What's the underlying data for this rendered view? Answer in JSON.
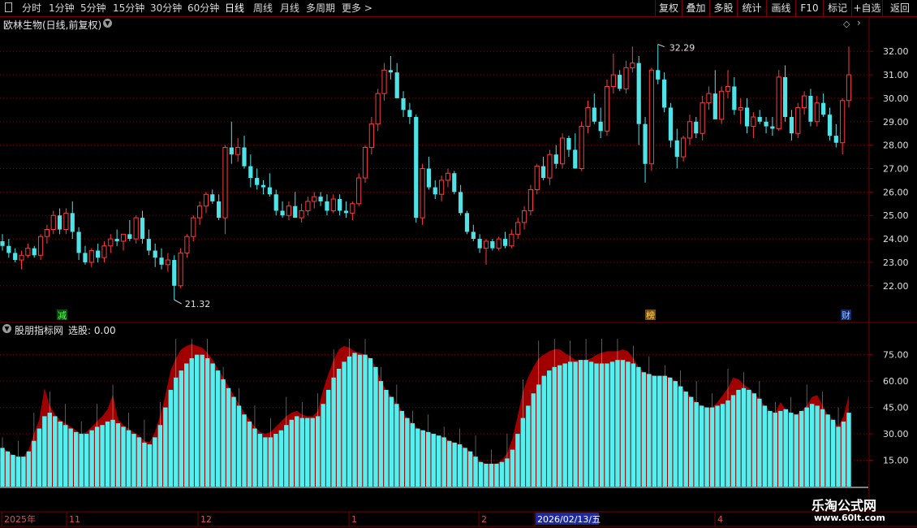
{
  "toolbar": {
    "menu_icon": "window-icon",
    "left": [
      "分时",
      "1分钟",
      "5分钟",
      "15分钟",
      "30分钟",
      "60分钟",
      "日线",
      "周线",
      "月线",
      "多周期",
      "更多 >"
    ],
    "active": "日线",
    "right": [
      "复权",
      "叠加",
      "多股",
      "统计",
      "画线",
      "F10",
      "标记",
      "+自选",
      "返回"
    ]
  },
  "stock": {
    "title": "欧林生物(日线,前复权)"
  },
  "indicator": {
    "name": "股朋指标网",
    "label": "选股: 0.00"
  },
  "annotations": {
    "high": "32.29",
    "low": "21.32",
    "marker_jian": "减",
    "marker_bang": "榜",
    "marker_cai": "财"
  },
  "colors": {
    "up": "#ff3b3b",
    "down": "#4fe3e8",
    "bar": "#54f0f0",
    "overlay": "#a00000",
    "grid": "#7a0000",
    "axis": "#e0e0e0"
  },
  "watermark": {
    "title": "乐淘公式网",
    "url": "www.60lt.com"
  },
  "chart_data": [
    {
      "type": "candlestick",
      "title": "欧林生物(日线,前复权)",
      "ylim": [
        21.3,
        32.7
      ],
      "y_ticks": [
        "22.00",
        "23.00",
        "24.00",
        "25.00",
        "26.00",
        "27.00",
        "28.00",
        "29.00",
        "30.00",
        "31.00",
        "32.00"
      ],
      "x_labels": [
        "2025年",
        "11",
        "12",
        "1",
        "2",
        "2026/02/13/五",
        "4"
      ],
      "candles_ohlc": [
        [
          23.9,
          24.2,
          23.5,
          23.7
        ],
        [
          23.7,
          24.0,
          23.2,
          23.4
        ],
        [
          23.4,
          23.6,
          23.0,
          23.1
        ],
        [
          23.1,
          23.5,
          22.7,
          23.3
        ],
        [
          23.3,
          23.8,
          23.2,
          23.6
        ],
        [
          23.6,
          23.7,
          23.2,
          23.3
        ],
        [
          23.3,
          24.2,
          23.1,
          24.1
        ],
        [
          24.1,
          24.6,
          23.8,
          24.4
        ],
        [
          24.4,
          25.2,
          24.2,
          25.0
        ],
        [
          25.0,
          25.3,
          24.2,
          24.4
        ],
        [
          24.4,
          25.3,
          24.2,
          25.1
        ],
        [
          25.1,
          25.6,
          24.0,
          24.3
        ],
        [
          24.3,
          24.5,
          23.1,
          23.4
        ],
        [
          23.4,
          23.7,
          22.9,
          23.0
        ],
        [
          23.0,
          23.6,
          22.8,
          23.5
        ],
        [
          23.5,
          23.8,
          23.0,
          23.2
        ],
        [
          23.2,
          23.9,
          23.0,
          23.7
        ],
        [
          23.7,
          24.2,
          23.4,
          24.0
        ],
        [
          24.0,
          24.4,
          23.7,
          23.9
        ],
        [
          23.9,
          24.2,
          23.5,
          24.2
        ],
        [
          24.2,
          24.8,
          23.9,
          24.0
        ],
        [
          24.0,
          25.0,
          23.8,
          24.9
        ],
        [
          24.9,
          25.2,
          23.8,
          24.0
        ],
        [
          24.0,
          24.4,
          23.3,
          23.5
        ],
        [
          23.5,
          23.8,
          22.8,
          23.2
        ],
        [
          23.2,
          23.6,
          22.7,
          22.9
        ],
        [
          22.9,
          23.4,
          22.6,
          23.1
        ],
        [
          23.1,
          23.3,
          21.4,
          22.0
        ],
        [
          22.0,
          23.6,
          21.9,
          23.4
        ],
        [
          23.4,
          24.2,
          23.2,
          24.1
        ],
        [
          24.1,
          25.0,
          23.9,
          24.9
        ],
        [
          24.9,
          25.6,
          24.6,
          25.4
        ],
        [
          25.4,
          26.0,
          25.1,
          25.9
        ],
        [
          25.9,
          26.1,
          25.5,
          25.6
        ],
        [
          25.6,
          25.9,
          24.8,
          24.9
        ],
        [
          24.9,
          28.0,
          24.2,
          27.9
        ],
        [
          27.9,
          29.0,
          27.2,
          27.6
        ],
        [
          27.6,
          28.3,
          27.3,
          27.9
        ],
        [
          27.9,
          28.4,
          27.0,
          27.1
        ],
        [
          27.1,
          27.6,
          26.2,
          26.6
        ],
        [
          26.6,
          27.0,
          26.1,
          26.3
        ],
        [
          26.3,
          26.5,
          25.9,
          26.2
        ],
        [
          26.2,
          26.8,
          25.8,
          25.9
        ],
        [
          25.9,
          26.1,
          25.0,
          25.2
        ],
        [
          25.2,
          25.6,
          24.9,
          25.0
        ],
        [
          25.0,
          25.6,
          24.8,
          25.4
        ],
        [
          25.4,
          26.0,
          25.0,
          24.9
        ],
        [
          24.9,
          25.5,
          24.7,
          25.2
        ],
        [
          25.2,
          25.8,
          25.0,
          25.6
        ],
        [
          25.6,
          26.0,
          25.3,
          25.8
        ],
        [
          25.8,
          26.0,
          25.4,
          25.6
        ],
        [
          25.6,
          25.9,
          25.0,
          25.2
        ],
        [
          25.2,
          25.9,
          25.1,
          25.7
        ],
        [
          25.7,
          25.9,
          25.0,
          25.2
        ],
        [
          25.2,
          25.6,
          24.9,
          25.1
        ],
        [
          25.1,
          25.6,
          24.8,
          25.5
        ],
        [
          25.5,
          26.8,
          25.4,
          26.6
        ],
        [
          26.6,
          28.0,
          26.4,
          27.9
        ],
        [
          27.9,
          29.2,
          27.6,
          28.9
        ],
        [
          28.9,
          30.4,
          28.6,
          30.2
        ],
        [
          30.2,
          31.5,
          29.9,
          31.2
        ],
        [
          31.2,
          31.8,
          30.8,
          31.1
        ],
        [
          31.1,
          31.5,
          30.3,
          30.0
        ],
        [
          30.0,
          30.3,
          29.2,
          29.5
        ],
        [
          29.5,
          29.8,
          28.9,
          29.2
        ],
        [
          29.2,
          29.3,
          24.7,
          24.9
        ],
        [
          24.9,
          27.2,
          24.6,
          27.0
        ],
        [
          27.0,
          27.5,
          26.1,
          26.2
        ],
        [
          26.2,
          26.5,
          25.7,
          25.9
        ],
        [
          25.9,
          26.7,
          25.6,
          26.5
        ],
        [
          26.5,
          27.0,
          26.2,
          26.8
        ],
        [
          26.8,
          26.9,
          25.9,
          26.0
        ],
        [
          26.0,
          26.3,
          25.0,
          25.1
        ],
        [
          25.1,
          25.2,
          24.2,
          24.3
        ],
        [
          24.3,
          24.6,
          23.9,
          24.0
        ],
        [
          24.0,
          24.2,
          23.4,
          23.6
        ],
        [
          23.6,
          24.0,
          22.9,
          23.9
        ],
        [
          23.9,
          24.0,
          23.5,
          23.6
        ],
        [
          23.6,
          24.1,
          23.5,
          24.0
        ],
        [
          24.0,
          24.3,
          23.6,
          23.7
        ],
        [
          23.7,
          24.4,
          23.6,
          24.2
        ],
        [
          24.2,
          24.9,
          24.0,
          24.7
        ],
        [
          24.7,
          25.4,
          24.4,
          25.2
        ],
        [
          25.2,
          26.3,
          25.0,
          26.1
        ],
        [
          26.1,
          27.2,
          25.9,
          27.1
        ],
        [
          27.1,
          27.5,
          26.5,
          26.6
        ],
        [
          26.6,
          27.8,
          26.3,
          27.6
        ],
        [
          27.6,
          28.0,
          27.0,
          27.2
        ],
        [
          27.2,
          28.5,
          27.0,
          28.3
        ],
        [
          28.3,
          28.4,
          27.5,
          27.8
        ],
        [
          27.8,
          28.5,
          27.0,
          27.0
        ],
        [
          27.0,
          29.0,
          26.9,
          28.8
        ],
        [
          28.8,
          29.9,
          28.5,
          29.6
        ],
        [
          29.6,
          30.2,
          28.9,
          29.0
        ],
        [
          29.0,
          29.6,
          28.3,
          28.6
        ],
        [
          28.6,
          30.8,
          28.4,
          30.5
        ],
        [
          30.5,
          31.9,
          30.2,
          31.0
        ],
        [
          31.0,
          31.2,
          30.3,
          30.4
        ],
        [
          30.4,
          31.6,
          30.2,
          31.3
        ],
        [
          31.3,
          32.2,
          31.1,
          31.5
        ],
        [
          31.5,
          31.8,
          28.0,
          28.9
        ],
        [
          28.9,
          29.2,
          26.4,
          27.2
        ],
        [
          27.2,
          31.3,
          26.9,
          31.2
        ],
        [
          31.2,
          32.3,
          30.6,
          30.8
        ],
        [
          30.8,
          31.1,
          29.4,
          29.6
        ],
        [
          29.6,
          29.8,
          27.9,
          28.2
        ],
        [
          28.2,
          28.7,
          27.0,
          27.5
        ],
        [
          27.5,
          28.4,
          27.3,
          28.3
        ],
        [
          28.3,
          29.3,
          28.0,
          29.0
        ],
        [
          29.0,
          29.2,
          28.3,
          28.5
        ],
        [
          28.5,
          30.1,
          28.2,
          29.8
        ],
        [
          29.8,
          30.5,
          29.5,
          30.2
        ],
        [
          30.2,
          31.2,
          29.7,
          29.1
        ],
        [
          29.1,
          30.5,
          28.9,
          30.3
        ],
        [
          30.3,
          31.2,
          30.0,
          30.5
        ],
        [
          30.5,
          30.9,
          29.3,
          29.5
        ],
        [
          29.5,
          30.0,
          28.9,
          29.6
        ],
        [
          29.6,
          30.0,
          28.5,
          28.8
        ],
        [
          28.8,
          29.4,
          28.3,
          29.2
        ],
        [
          29.2,
          29.5,
          28.9,
          29.0
        ],
        [
          29.0,
          29.2,
          28.5,
          28.8
        ],
        [
          28.8,
          29.2,
          28.4,
          28.7
        ],
        [
          28.7,
          31.2,
          28.6,
          30.9
        ],
        [
          30.9,
          31.4,
          29.0,
          29.2
        ],
        [
          29.2,
          29.5,
          28.2,
          28.5
        ],
        [
          28.5,
          29.8,
          28.3,
          29.6
        ],
        [
          29.6,
          30.3,
          29.3,
          30.1
        ],
        [
          30.1,
          30.4,
          28.8,
          29.0
        ],
        [
          29.0,
          30.1,
          28.8,
          29.8
        ],
        [
          29.8,
          30.2,
          29.2,
          29.3
        ],
        [
          29.3,
          29.6,
          28.2,
          28.4
        ],
        [
          28.4,
          28.9,
          27.9,
          28.1
        ],
        [
          28.1,
          30.0,
          27.6,
          29.9
        ],
        [
          29.9,
          32.2,
          29.6,
          31.0
        ]
      ]
    },
    {
      "type": "bar",
      "title": "股朋指标网",
      "ylim": [
        0,
        85
      ],
      "y_ticks": [
        "15.00",
        "30.00",
        "45.00",
        "60.00",
        "75.00"
      ],
      "values": [
        22,
        20,
        18,
        17,
        17,
        20,
        26,
        33,
        40,
        42,
        40,
        37,
        35,
        33,
        31,
        30,
        30,
        32,
        34,
        35,
        37,
        38,
        36,
        34,
        32,
        30,
        28,
        25,
        24,
        28,
        35,
        45,
        55,
        62,
        66,
        70,
        73,
        75,
        75,
        73,
        70,
        66,
        61,
        56,
        51,
        46,
        41,
        37,
        33,
        30,
        28,
        28,
        30,
        32,
        35,
        38,
        40,
        39,
        39,
        39,
        40,
        47,
        55,
        62,
        67,
        71,
        74,
        76,
        75,
        75,
        73,
        68,
        60,
        55,
        51,
        47,
        43,
        39,
        36,
        33,
        32,
        31,
        30,
        29,
        28,
        26,
        25,
        24,
        22,
        20,
        17,
        14,
        13,
        13,
        13,
        14,
        16,
        21,
        30,
        39,
        46,
        53,
        58,
        63,
        66,
        68,
        69,
        70,
        71,
        71,
        72,
        72,
        71,
        70,
        70,
        70,
        71,
        72,
        72,
        71,
        70,
        68,
        65,
        64,
        63,
        63,
        63,
        62,
        60,
        57,
        54,
        51,
        48,
        46,
        45,
        45,
        46,
        47,
        49,
        52,
        55,
        56,
        55,
        53,
        50,
        46,
        43,
        42,
        43,
        44,
        42,
        41,
        43,
        45,
        47,
        46,
        44,
        41,
        38,
        34,
        37,
        42
      ],
      "overlay_values": [
        22,
        20,
        18,
        17,
        17,
        21,
        30,
        38,
        56,
        46,
        41,
        38,
        36,
        34,
        32,
        30,
        31,
        34,
        37,
        40,
        44,
        52,
        38,
        35,
        33,
        31,
        29,
        26,
        25,
        31,
        40,
        52,
        66,
        73,
        78,
        80,
        81,
        80,
        79,
        76,
        72,
        67,
        62,
        57,
        52,
        47,
        42,
        38,
        34,
        31,
        30,
        31,
        34,
        37,
        40,
        42,
        43,
        41,
        40,
        40,
        43,
        55,
        64,
        72,
        78,
        80,
        79,
        77,
        76,
        75,
        73,
        68,
        60,
        55,
        51,
        47,
        43,
        39,
        36,
        33,
        32,
        31,
        30,
        29,
        28,
        26,
        25,
        24,
        22,
        20,
        17,
        14,
        13,
        13,
        13,
        15,
        19,
        27,
        40,
        54,
        62,
        68,
        73,
        75,
        77,
        78,
        78,
        76,
        74,
        72,
        72,
        72,
        73,
        75,
        76,
        77,
        77,
        77,
        78,
        77,
        73,
        68,
        65,
        64,
        63,
        63,
        63,
        62,
        60,
        57,
        54,
        51,
        48,
        46,
        45,
        45,
        48,
        52,
        56,
        62,
        61,
        58,
        56,
        53,
        50,
        46,
        43,
        42,
        48,
        44,
        42,
        41,
        43,
        46,
        51,
        52,
        46,
        41,
        38,
        34,
        40,
        52
      ]
    }
  ]
}
